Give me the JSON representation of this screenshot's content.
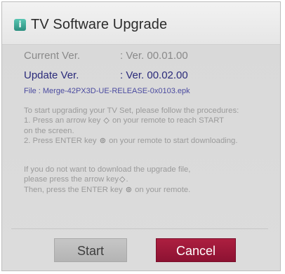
{
  "dialog": {
    "title": "TV Software Upgrade",
    "title_icon": "info-icon"
  },
  "versions": {
    "current_label": "Current Ver.",
    "current_value": ": Ver. 00.01.00",
    "update_label": "Update Ver.",
    "update_value": ": Ver. 00.02.00"
  },
  "file": "File : Merge-42PX3D-UE-RELEASE-0x0103.epk",
  "instructions": {
    "line1": "To start upgrading your TV Set, please follow the procedures:",
    "line2a": "1. Press an arrow key ",
    "line2b": " on your remote to reach START",
    "line3": "on the screen.",
    "line4a": "2. Press ENTER key ",
    "line4b": " on your remote to start downloading."
  },
  "cancel_instructions": {
    "line1": "If you do not want to download the upgrade file,",
    "line2a": "please press the arrow key",
    "line2b": ".",
    "line3a": "Then, press the ENTER key ",
    "line3b": " on your remote."
  },
  "glyphs": {
    "arrow_key": "◇",
    "enter_key": "⊚"
  },
  "buttons": {
    "start": "Start",
    "cancel": "Cancel"
  },
  "colors": {
    "cancel_button": "#9a1838",
    "start_button": "#bdbdbd",
    "update_text": "#2a2a7a",
    "icon": "#3aa894"
  }
}
